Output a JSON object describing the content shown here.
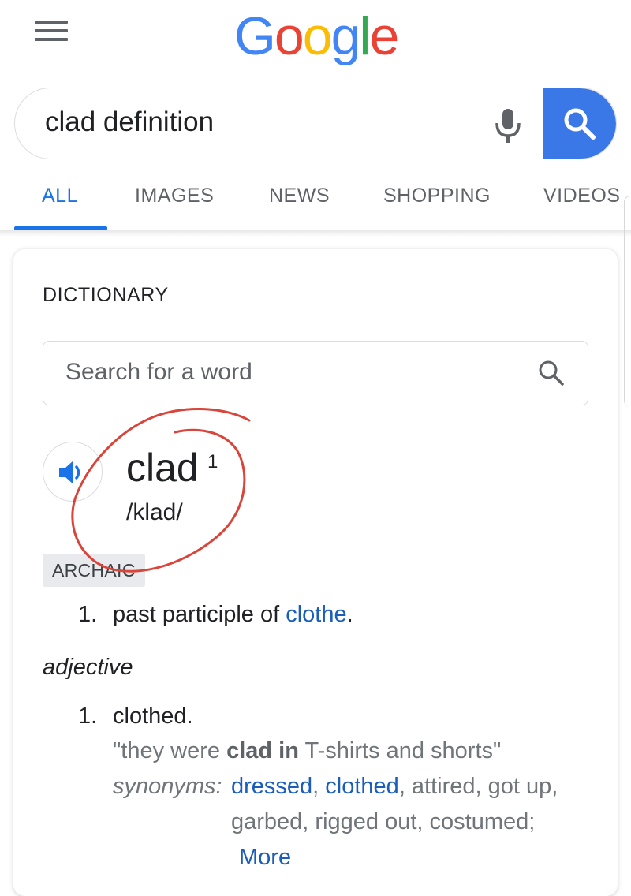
{
  "header": {
    "logo_letters": [
      {
        "char": "G",
        "color": "#4285f4"
      },
      {
        "char": "o",
        "color": "#ea4335"
      },
      {
        "char": "o",
        "color": "#fbbc05"
      },
      {
        "char": "g",
        "color": "#4285f4"
      },
      {
        "char": "l",
        "color": "#34a853"
      },
      {
        "char": "e",
        "color": "#ea4335"
      }
    ],
    "menu_icon": "hamburger-menu-icon"
  },
  "search": {
    "query": "clad definition",
    "mic_icon": "microphone-icon",
    "button_icon": "search-icon",
    "button_color": "#3b78e7"
  },
  "tabs": [
    {
      "label": "ALL",
      "active": true
    },
    {
      "label": "IMAGES",
      "active": false
    },
    {
      "label": "NEWS",
      "active": false
    },
    {
      "label": "SHOPPING",
      "active": false
    },
    {
      "label": "VIDEOS",
      "active": false
    }
  ],
  "dictionary": {
    "title": "DICTIONARY",
    "search_placeholder": "Search for a word",
    "word": "clad",
    "word_superscript": "1",
    "pronunciation": "/klad/",
    "speaker_icon": "speaker-icon",
    "register_badge": "ARCHAIC",
    "sense_1": {
      "number": "1.",
      "text_before": "past participle of ",
      "link": "clothe",
      "text_after": "."
    },
    "part_of_speech": "adjective",
    "sense_2": {
      "number": "1.",
      "definition": "clothed.",
      "example_open": "\"they were ",
      "example_bold": "clad in",
      "example_close": " T-shirts and shorts\"",
      "synonyms_label": "synonyms:",
      "synonym_links": [
        "dressed",
        "clothed"
      ],
      "synonyms_line1_rest": ", attired, got up,",
      "synonyms_line2": "garbed, rigged out, costumed;",
      "more_label": "More"
    }
  },
  "colors": {
    "link": "#1a5dbb",
    "active_tab": "#1a73e8",
    "annotation_circle": "#d9453a"
  }
}
